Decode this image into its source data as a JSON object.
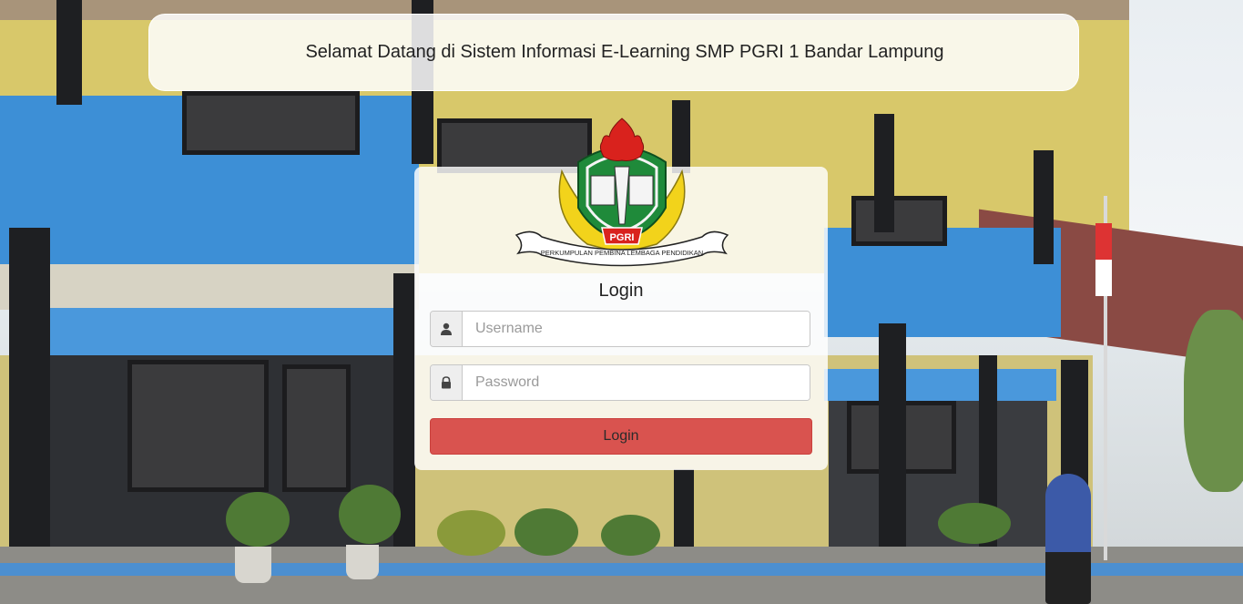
{
  "header": {
    "title": "Selamat Datang di Sistem Informasi E-Learning SMP PGRI 1 Bandar Lampung"
  },
  "logo": {
    "badge_text": "PGRI",
    "ribbon_text": "PERKUMPULAN PEMBINA LEMBAGA PENDIDIKAN"
  },
  "login": {
    "title": "Login",
    "username_placeholder": "Username",
    "password_placeholder": "Password",
    "submit_label": "Login"
  },
  "icons": {
    "username": "user-icon",
    "password": "lock-icon"
  },
  "colors": {
    "login_button": "#d9534f",
    "logo_green": "#1f8a3a",
    "logo_yellow": "#f2d31b",
    "logo_red": "#d9221d"
  }
}
